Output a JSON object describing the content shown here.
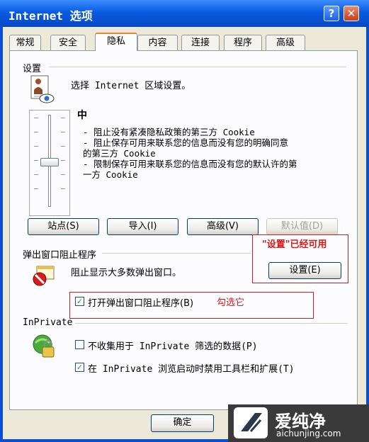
{
  "window": {
    "title": "Internet 选项",
    "help_glyph": "?",
    "close_glyph": "✕"
  },
  "tabs": [
    "常规",
    "安全",
    "隐私",
    "内容",
    "连接",
    "程序",
    "高级"
  ],
  "active_tab_index": 2,
  "settings": {
    "section_label": "设置",
    "zone_text": "选择 Internet 区域设置。",
    "level_label": "中",
    "desc_lines": [
      "- 阻止没有紧凑隐私政策的第三方 Cookie",
      "- 阻止保存可用来联系您的信息而没有您的明确同意",
      "的第三方 Cookie",
      "- 限制保存可用来联系您的信息而没有您的默认许的第",
      "一方 Cookie"
    ],
    "buttons": {
      "sites": "站点(S)",
      "import": "导入(I)",
      "advanced": "高级(V)",
      "default": "默认值(D)"
    }
  },
  "popup": {
    "section_label": "弹出窗口阻止程序",
    "desc": "阻止显示大多数弹出窗口。",
    "settings_button": "设置(E)",
    "enable_checkbox_label": "打开弹出窗口阻止程序(B)",
    "enable_checked": true
  },
  "annotations": {
    "settings_available": "\"设置\"已经可用",
    "check_it": "勾选它"
  },
  "inprivate": {
    "section_label": "InPrivate",
    "no_collect_label": "不收集用于 InPrivate 筛选的数据(P)",
    "no_collect_checked": false,
    "disable_toolbars_label": "在 InPrivate 浏览启动时禁用工具栏和扩展(T)",
    "disable_toolbars_checked": true
  },
  "footer": {
    "ok_button": "确定"
  },
  "watermark": {
    "logo_text": "爱纯净",
    "url": "aichunjing.com"
  },
  "colors": {
    "title_blue": "#0a5be0",
    "red_annotation": "#d21b1b"
  }
}
